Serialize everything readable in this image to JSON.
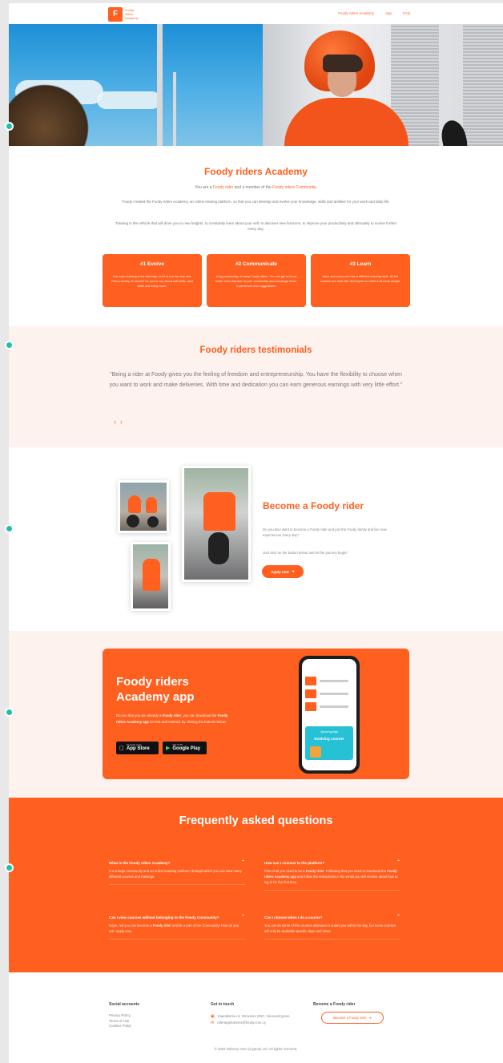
{
  "nav": {
    "logo_mark": "F",
    "logo_text": "Foody riders Academy",
    "links": [
      "Foody riders Academy",
      "App",
      "FAQ"
    ]
  },
  "intro": {
    "title": "Foody riders Academy",
    "line1_pre": "You are a ",
    "line1_link1": "Foody rider",
    "line1_mid": " and a member of the ",
    "line1_link2": "Foody riders Community",
    "line1_post": ".",
    "para1": "Foody created the Foody riders Academy, an online training platform, so that you can develop and evolve your knowledge, skills and abilities for your work and daily life.",
    "para2": "Training is the vehicle that will drive you to new heights, to constantly learn about your self, to discover new horizons, to improve your productivity and ultimately to evolve further every day.",
    "cards": [
      {
        "title": "#1 Evolve",
        "body": "The basic training is the first step, but it is not the only one. Find a variety of courses for you to use about soft skills, hard skills and many more."
      },
      {
        "title": "#2 Communicate",
        "body": "A big community of many Foody riders. You can get to know better each member of your community and exchange ideas, experiences and suggestions."
      },
      {
        "title": "#3 Learn",
        "body": "Each and every one has a different learning style. All the courses are built with techniques to make it all more simple."
      }
    ]
  },
  "testimonials": {
    "title": "Foody riders testimonials",
    "quote": "\"Being a rider at Foody gives you the feeling of freedom and entrepreneurship. You have the flexibility to choose when you want to work and make deliveries. With time and dedication you can earn generous earnings with very little effort.\"",
    "prev": "‹",
    "next": "›"
  },
  "become": {
    "title": "Become a Foody rider",
    "para1": "Do you also want to become a Foody rider and join the Foody family and live new experiences every day?",
    "para2": "Just click on the button below and let the journey begin!",
    "button": "Apply now"
  },
  "app": {
    "title": "Foody riders Academy app",
    "desc_pre": "Do you that you are already a ",
    "desc_b1": "Foody rider",
    "desc_mid": ", you can download the ",
    "desc_b2": "Foody riders Academy app",
    "desc_post": " for iOS and Android, by clicking the buttons below.",
    "appstore_small": "Download on the",
    "appstore_big": "App Store",
    "play_small": "GET IT ON",
    "play_big": "Google Play",
    "phone_card_top": "Upcoming days",
    "phone_card_title": "Evolving course!"
  },
  "faq": {
    "title": "Frequently asked questions",
    "items": [
      {
        "q": "What is the Foody riders Academy?",
        "a": "It is a large community and an online learning platform, through which you can view many different courses and trainings."
      },
      {
        "q": "How can I connect to the platform?",
        "a_pre": "First of all you need to be a ",
        "a_b1": "Foody rider",
        "a_mid": ". Following that you need to download the ",
        "a_b2": "Foody riders Academy app",
        "a_post": " and follow the instructions in the email you will receive about how to log in for the first time."
      },
      {
        "q": "Can I view courses without belonging to the Foody Community?",
        "a_pre": "Nope, not you can become a ",
        "a_b1": "Foody rider",
        "a_post": " and be a part of the Community! How do you ask: Apply now."
      },
      {
        "q": "Can I choose when I do a course?",
        "a": "You can do some of the courses whenever it suites you within the day, but some courses will only be available specific days and times."
      }
    ]
  },
  "footer": {
    "social_title": "Social accounts",
    "social_links": [
      "Privacy Policy",
      "Terms of Use",
      "Cookies Policy"
    ],
    "touch_title": "Get in touch",
    "address": "Kapodistriou 6, Strovolos 2057, Nicosia/Cyprus",
    "email": "riderapplications@foody.com.cy",
    "become_title": "Become a Foody rider",
    "become_button": "Become a Foody rider",
    "copyright": "© 2022 Delivery Hero (Cyprus) Ltd. All rights reserved."
  }
}
